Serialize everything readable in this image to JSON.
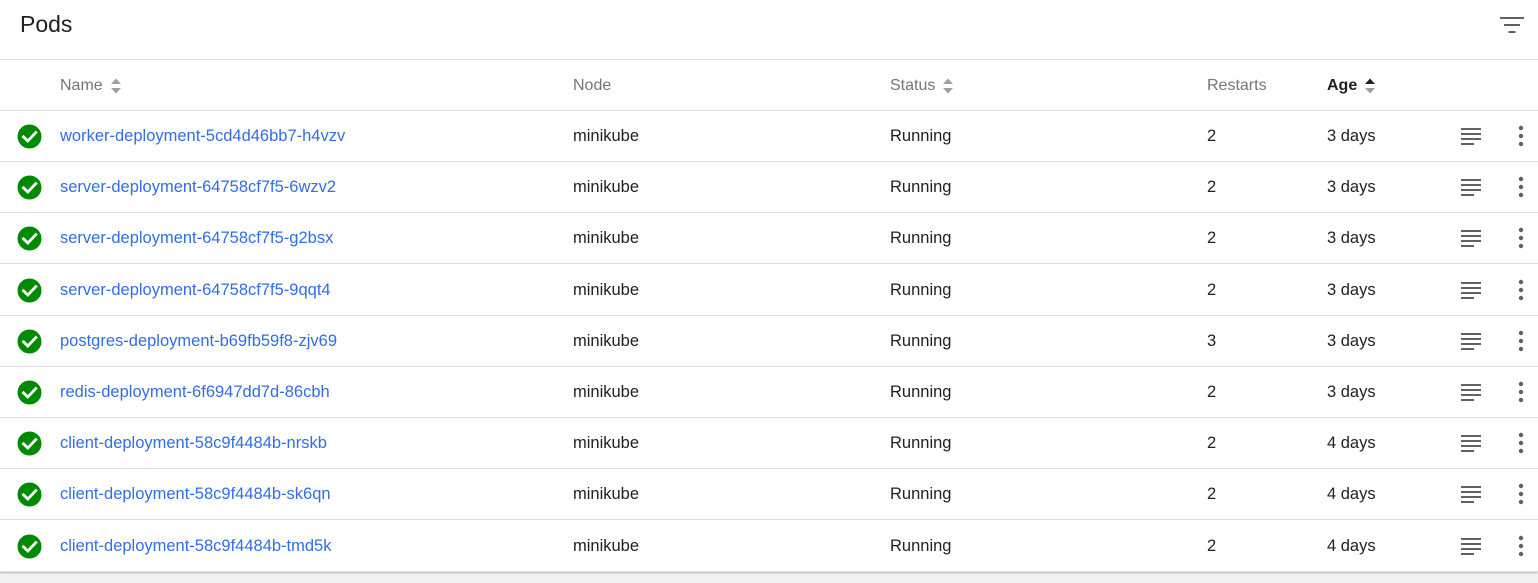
{
  "header": {
    "title": "Pods",
    "filter_icon": "filter-list-icon"
  },
  "columns": {
    "name": "Name",
    "node": "Node",
    "status": "Status",
    "restarts": "Restarts",
    "age": "Age"
  },
  "colors": {
    "link": "#326de6",
    "success": "#008a00",
    "text": "#212121",
    "header_text": "#757575"
  },
  "rows": [
    {
      "name": "worker-deployment-5cd4d46bb7-h4vzv",
      "node": "minikube",
      "status": "Running",
      "restarts": "2",
      "age": "3 days"
    },
    {
      "name": "server-deployment-64758cf7f5-6wzv2",
      "node": "minikube",
      "status": "Running",
      "restarts": "2",
      "age": "3 days"
    },
    {
      "name": "server-deployment-64758cf7f5-g2bsx",
      "node": "minikube",
      "status": "Running",
      "restarts": "2",
      "age": "3 days"
    },
    {
      "name": "server-deployment-64758cf7f5-9qqt4",
      "node": "minikube",
      "status": "Running",
      "restarts": "2",
      "age": "3 days"
    },
    {
      "name": "postgres-deployment-b69fb59f8-zjv69",
      "node": "minikube",
      "status": "Running",
      "restarts": "3",
      "age": "3 days"
    },
    {
      "name": "redis-deployment-6f6947dd7d-86cbh",
      "node": "minikube",
      "status": "Running",
      "restarts": "2",
      "age": "3 days"
    },
    {
      "name": "client-deployment-58c9f4484b-nrskb",
      "node": "minikube",
      "status": "Running",
      "restarts": "2",
      "age": "4 days"
    },
    {
      "name": "client-deployment-58c9f4484b-sk6qn",
      "node": "minikube",
      "status": "Running",
      "restarts": "2",
      "age": "4 days"
    },
    {
      "name": "client-deployment-58c9f4484b-tmd5k",
      "node": "minikube",
      "status": "Running",
      "restarts": "2",
      "age": "4 days"
    }
  ]
}
